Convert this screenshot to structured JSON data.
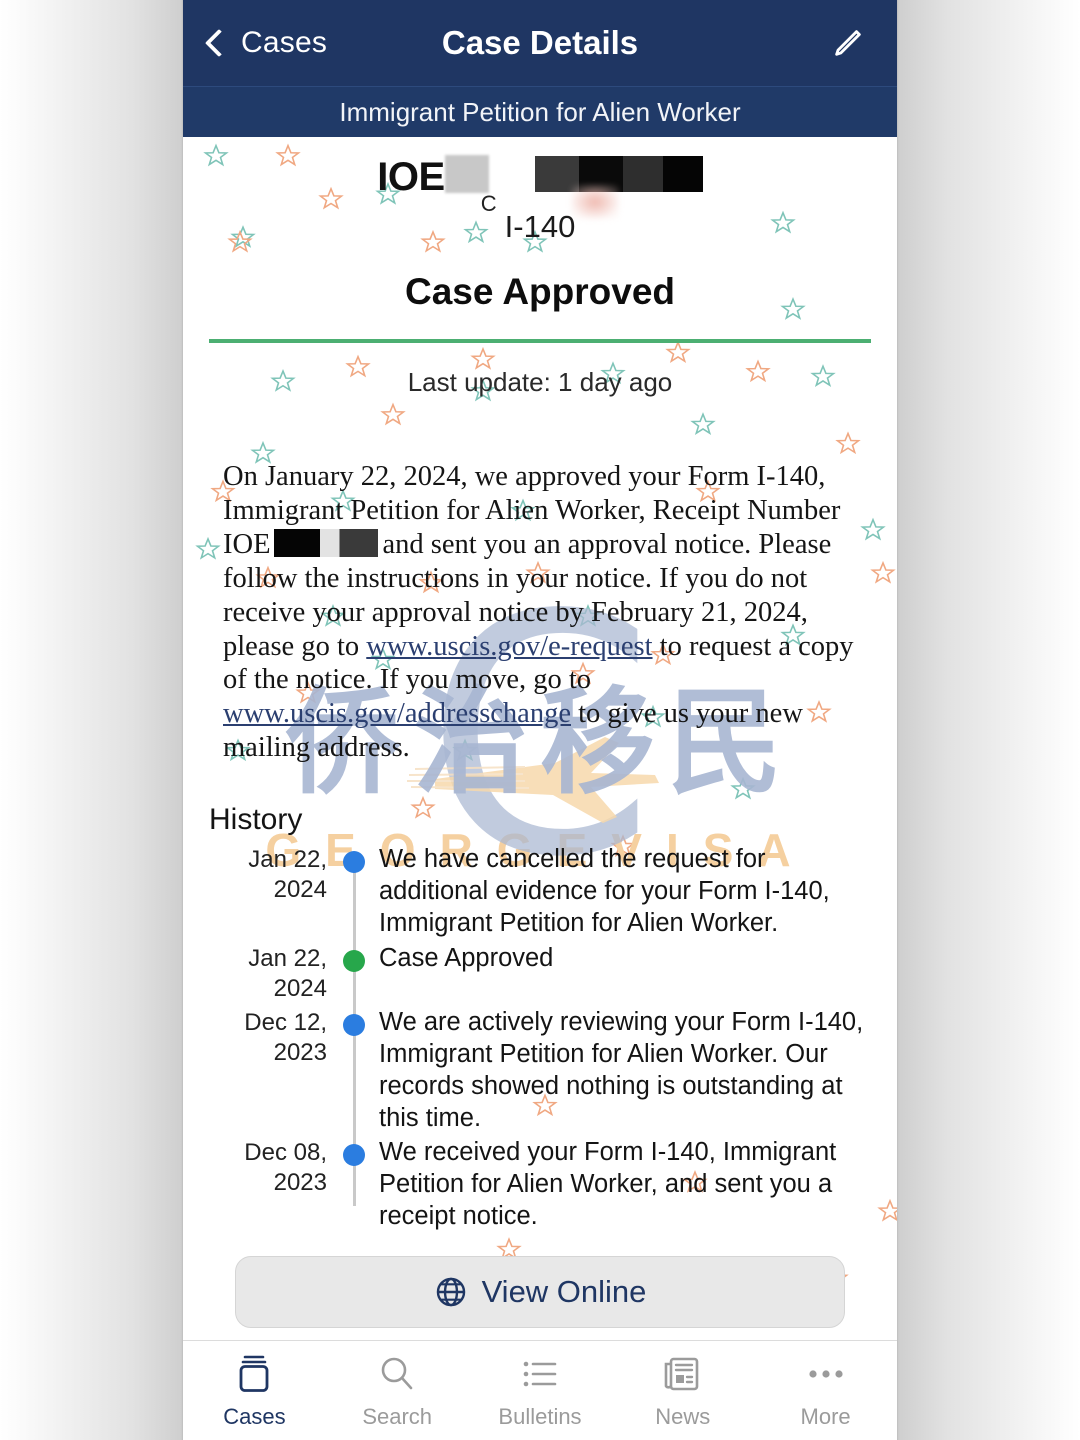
{
  "navbar": {
    "back_label": "Cases",
    "title": "Case Details",
    "back_icon": "chevron-left-icon",
    "edit_icon": "pencil-icon"
  },
  "subbar": {
    "form_title": "Immigrant Petition for Alien Worker"
  },
  "case": {
    "receipt_prefix": "IOE",
    "receipt_redacted": true,
    "center_letter": "C",
    "form_number": "I-140",
    "status": "Case Approved",
    "last_update": "Last update: 1 day ago",
    "divider_color": "#4caf72"
  },
  "message": {
    "part1": "On January 22, 2024, we approved your Form I-140, Immigrant Petition for Alien Worker, Receipt Number IOE",
    "part2": "and sent you an approval notice. Please follow the instructions in your notice. If you do not receive your approval notice by February 21, 2024, please go to ",
    "link1": "www.uscis.gov/e-request",
    "part3": " to request a copy of the notice. If you move, go to ",
    "link2": "www.uscis.gov/addresschange",
    "part4": " to give us your new mailing address."
  },
  "history": {
    "title": "History",
    "items": [
      {
        "date": "Jan 22, 2024",
        "dot": "blue",
        "text": "We have cancelled the request for additional evidence for your Form I-140, Immigrant Petition for Alien Worker."
      },
      {
        "date": "Jan 22, 2024",
        "dot": "green",
        "text": "Case Approved"
      },
      {
        "date": "Dec 12, 2023",
        "dot": "blue",
        "text": "We are actively reviewing your Form I-140, Immigrant Petition for Alien Worker. Our records showed nothing is outstanding at this time."
      },
      {
        "date": "Dec 08, 2023",
        "dot": "blue",
        "text": "We received your Form I-140, Immigrant Petition for Alien Worker, and sent you a receipt notice."
      }
    ]
  },
  "watermark": {
    "chinese": "侨治移民",
    "english": "GEORGEVISA",
    "color_cn": "#a8b6d2",
    "color_en": "#f5d0a0"
  },
  "view_online": {
    "label": "View Online",
    "icon": "globe-icon"
  },
  "tabbar": {
    "items": [
      {
        "label": "Cases",
        "icon": "cases-icon",
        "active": true
      },
      {
        "label": "Search",
        "icon": "search-icon",
        "active": false
      },
      {
        "label": "Bulletins",
        "icon": "bulletins-icon",
        "active": false
      },
      {
        "label": "News",
        "icon": "news-icon",
        "active": false
      },
      {
        "label": "More",
        "icon": "more-icon",
        "active": false
      }
    ]
  },
  "theme": {
    "navy": "#1f3663",
    "green": "#4caf72",
    "blue_dot": "#2b7de0",
    "green_dot": "#27a74b",
    "star_teal": "#7fc4b8",
    "star_salmon": "#f0a882"
  }
}
